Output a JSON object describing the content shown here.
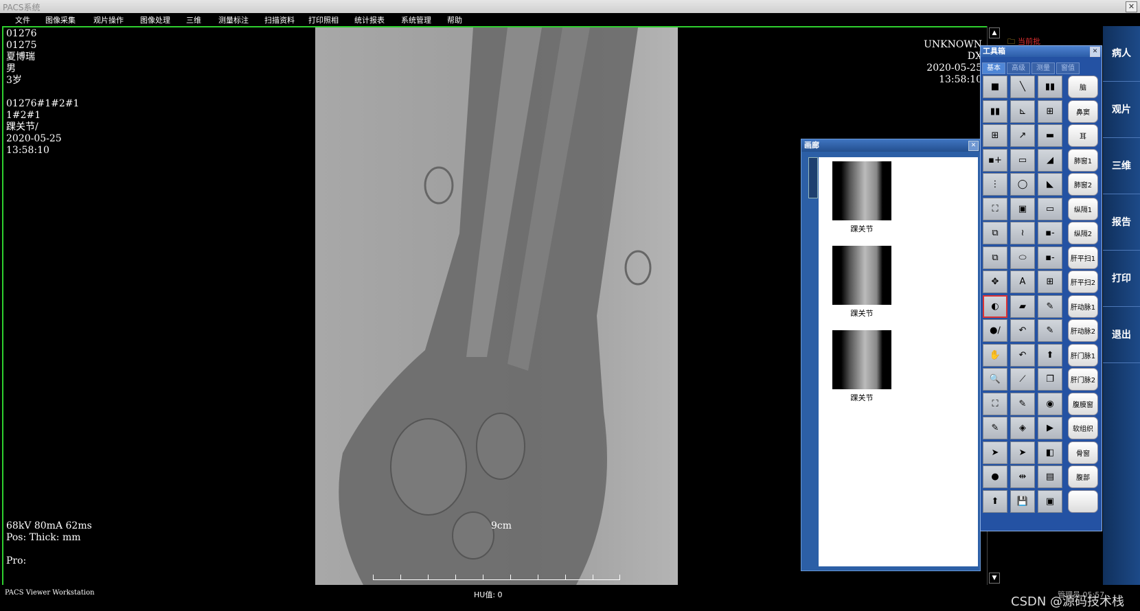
{
  "window": {
    "title": "PACS系统",
    "close": "✕"
  },
  "menu": [
    "文件",
    "图像采集",
    "观片操作",
    "图像处理",
    "三维",
    "测量标注",
    "扫描资料",
    "打印照相",
    "统计报表",
    "系统管理",
    "帮助"
  ],
  "overlay": {
    "tl": "01276\n01275\n夏博瑞\n男\n3岁\n\n01276#1#2#1\n1#2#1\n踝关节/\n2020-05-25\n13:58:10",
    "tr": "UNKNOWN\nDX\n2020-05-25\n13:58:10",
    "bl": "68kV 80mA 62ms\nPos: Thick: mm\n\nPro:",
    "scale": "9cm"
  },
  "status": {
    "left": "PACS Viewer Workstation",
    "mid": "HU值: 0",
    "right": "管理员  05:57",
    "watermark": "CSDN @源码技术栈"
  },
  "gallery": {
    "title": "画廊",
    "thumbs": [
      "踝关节",
      "踝关节",
      "踝关节"
    ]
  },
  "folder": {
    "label": "当前批"
  },
  "toolbox": {
    "title": "工具箱",
    "tabs": [
      "基本",
      "高级",
      "测量",
      "窗值"
    ],
    "presets": [
      "脑",
      "鼻窦",
      "耳",
      "肺窗1",
      "肺窗2",
      "纵隔1",
      "纵隔2",
      "肝平扫1",
      "肝平扫2",
      "肝动脉1",
      "肝动脉2",
      "肝门脉1",
      "肝门脉2",
      "腹膜窗",
      "软组织",
      "骨窗",
      "腹部",
      ""
    ],
    "tool_glyphs": [
      [
        "■",
        "╲",
        "▮▮"
      ],
      [
        "▮▮",
        "⊾",
        "⊞"
      ],
      [
        "⊞",
        "↗",
        "▬"
      ],
      [
        "▪+",
        "▭",
        "◢"
      ],
      [
        "⋮",
        "◯",
        "◣"
      ],
      [
        "⛶",
        "▣",
        "▭"
      ],
      [
        "⧉",
        "≀",
        "▪-"
      ],
      [
        "⧉",
        "⬭",
        "▪-"
      ],
      [
        "✥",
        "A",
        "⊞"
      ],
      [
        "◐",
        "▰",
        "✎"
      ],
      [
        "●∕",
        "↶",
        "✎"
      ],
      [
        "✋",
        "↶",
        "⬆"
      ],
      [
        "🔍",
        "⟋",
        "❐"
      ],
      [
        "⛶",
        "✎",
        "◉"
      ],
      [
        "✎",
        "◈",
        "▶"
      ],
      [
        "➤",
        "➤",
        "◧"
      ],
      [
        "●",
        "⇹",
        "▤"
      ],
      [
        "⬆",
        "💾",
        "▣"
      ]
    ]
  },
  "sidebar": [
    "病人",
    "观片",
    "三维",
    "报告",
    "打印",
    "退出"
  ]
}
